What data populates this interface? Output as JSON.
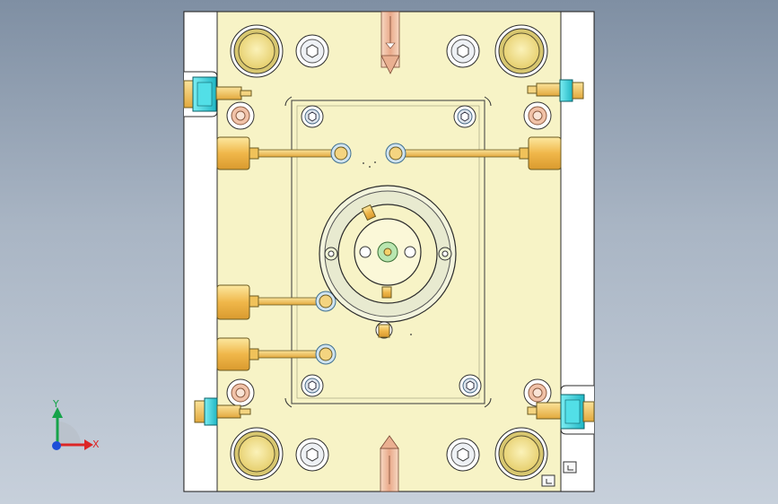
{
  "triad": {
    "y_label": "Y",
    "x_label": "X",
    "y_color": "#16a34a",
    "x_color": "#dc2626",
    "origin_color": "#1d4ed8"
  },
  "colors": {
    "plate": "#f7f3c6",
    "frame": "#ffffff",
    "outline": "#2b2b2b",
    "bushing": "#f2e497",
    "nozzle": "#f5c95e",
    "coupling": "#37d6df",
    "bolt": "#e9edf2",
    "pin": "#f4c7a8"
  },
  "icons": {
    "view_triad": "axis-triad-icon",
    "corner_marks": "corner-bracket-icon"
  }
}
